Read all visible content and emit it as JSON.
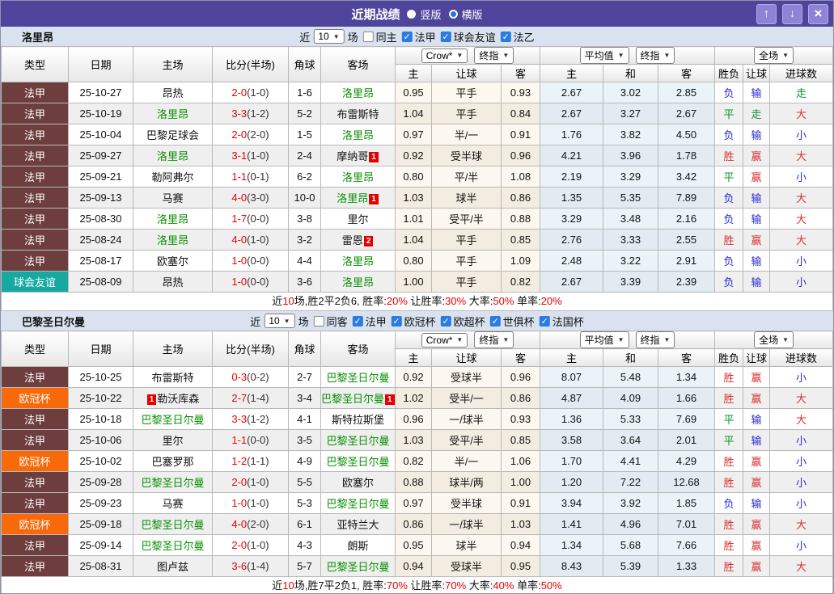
{
  "window": {
    "title": "近期战绩",
    "layout_radios": [
      {
        "label": "竖版",
        "selected": false
      },
      {
        "label": "横版",
        "selected": true
      }
    ],
    "controls": {
      "up": "↑",
      "down": "↓",
      "close": "×"
    },
    "titlebar_color": "#4e449b"
  },
  "table_template": {
    "static_cols": [
      "类型",
      "日期",
      "主场",
      "比分(半场)",
      "角球",
      "客场"
    ],
    "odds_group": {
      "selects": [
        "Crow*",
        "终指"
      ],
      "cols": [
        "主",
        "让球",
        "客"
      ]
    },
    "avg_group": {
      "selects": [
        "平均值",
        "终指"
      ],
      "cols": [
        "主",
        "和",
        "客"
      ]
    },
    "result_group": {
      "selects": [
        "全场"
      ],
      "cols": [
        "胜负",
        "让球",
        "进球数"
      ]
    }
  },
  "league_colors": {
    "法甲": "#6e3e3e",
    "球会友谊": "#17a8a2",
    "欧冠杯": "#f8690a"
  },
  "result_colors": {
    "r": "#d93333",
    "g": "#0b9431",
    "b": "#2b2bd5"
  },
  "team_green": "#089000",
  "sections": [
    {
      "team": "洛里昂",
      "filter": {
        "prefix": "近",
        "count": "10",
        "suffix": "场",
        "venue": {
          "label": "同主",
          "checked": false
        },
        "leagues": [
          {
            "label": "法甲",
            "checked": true
          },
          {
            "label": "球会友谊",
            "checked": true
          },
          {
            "label": "法乙",
            "checked": true
          }
        ]
      },
      "rows": [
        {
          "league": "法甲",
          "date": "25-10-27",
          "home": {
            "name": "昂热"
          },
          "ft": "2-0",
          "ht": "(1-0)",
          "corner": "1-6",
          "away": {
            "name": "洛里昂",
            "green": true
          },
          "crow": [
            "0.95",
            "平手",
            "0.93"
          ],
          "avg": [
            "2.67",
            "3.02",
            "2.85"
          ],
          "res": [
            [
              "负",
              "b"
            ],
            [
              "输",
              "b"
            ],
            [
              "走",
              "g"
            ]
          ]
        },
        {
          "league": "法甲",
          "date": "25-10-19",
          "home": {
            "name": "洛里昂",
            "green": true
          },
          "ft": "3-3",
          "ht": "(1-2)",
          "corner": "5-2",
          "away": {
            "name": "布雷斯特"
          },
          "crow": [
            "1.04",
            "平手",
            "0.84"
          ],
          "avg": [
            "2.67",
            "3.27",
            "2.67"
          ],
          "res": [
            [
              "平",
              "g"
            ],
            [
              "走",
              "g"
            ],
            [
              "大",
              "r"
            ]
          ]
        },
        {
          "league": "法甲",
          "date": "25-10-04",
          "home": {
            "name": "巴黎足球会"
          },
          "ft": "2-0",
          "ht": "(2-0)",
          "corner": "1-5",
          "away": {
            "name": "洛里昂",
            "green": true
          },
          "crow": [
            "0.97",
            "半/一",
            "0.91"
          ],
          "avg": [
            "1.76",
            "3.82",
            "4.50"
          ],
          "res": [
            [
              "负",
              "b"
            ],
            [
              "输",
              "b"
            ],
            [
              "小",
              "b"
            ]
          ]
        },
        {
          "league": "法甲",
          "date": "25-09-27",
          "home": {
            "name": "洛里昂",
            "green": true
          },
          "ft": "3-1",
          "ht": "(1-0)",
          "corner": "2-4",
          "away": {
            "name": "摩纳哥",
            "card": 1
          },
          "crow": [
            "0.92",
            "受半球",
            "0.96"
          ],
          "avg": [
            "4.21",
            "3.96",
            "1.78"
          ],
          "res": [
            [
              "胜",
              "r"
            ],
            [
              "赢",
              "r"
            ],
            [
              "大",
              "r"
            ]
          ]
        },
        {
          "league": "法甲",
          "date": "25-09-21",
          "home": {
            "name": "勒阿弗尔"
          },
          "ft": "1-1",
          "ht": "(0-1)",
          "corner": "6-2",
          "away": {
            "name": "洛里昂",
            "green": true
          },
          "crow": [
            "0.80",
            "平/半",
            "1.08"
          ],
          "avg": [
            "2.19",
            "3.29",
            "3.42"
          ],
          "res": [
            [
              "平",
              "g"
            ],
            [
              "赢",
              "r"
            ],
            [
              "小",
              "b"
            ]
          ]
        },
        {
          "league": "法甲",
          "date": "25-09-13",
          "home": {
            "name": "马赛"
          },
          "ft": "4-0",
          "ht": "(3-0)",
          "corner": "10-0",
          "away": {
            "name": "洛里昂",
            "green": true,
            "card": 1
          },
          "crow": [
            "1.03",
            "球半",
            "0.86"
          ],
          "avg": [
            "1.35",
            "5.35",
            "7.89"
          ],
          "res": [
            [
              "负",
              "b"
            ],
            [
              "输",
              "b"
            ],
            [
              "大",
              "r"
            ]
          ]
        },
        {
          "league": "法甲",
          "date": "25-08-30",
          "home": {
            "name": "洛里昂",
            "green": true
          },
          "ft": "1-7",
          "ht": "(0-0)",
          "corner": "3-8",
          "away": {
            "name": "里尔"
          },
          "crow": [
            "1.01",
            "受平/半",
            "0.88"
          ],
          "avg": [
            "3.29",
            "3.48",
            "2.16"
          ],
          "res": [
            [
              "负",
              "b"
            ],
            [
              "输",
              "b"
            ],
            [
              "大",
              "r"
            ]
          ]
        },
        {
          "league": "法甲",
          "date": "25-08-24",
          "home": {
            "name": "洛里昂",
            "green": true
          },
          "ft": "4-0",
          "ht": "(1-0)",
          "corner": "3-2",
          "away": {
            "name": "雷恩",
            "card": 2
          },
          "crow": [
            "1.04",
            "平手",
            "0.85"
          ],
          "avg": [
            "2.76",
            "3.33",
            "2.55"
          ],
          "res": [
            [
              "胜",
              "r"
            ],
            [
              "赢",
              "r"
            ],
            [
              "大",
              "r"
            ]
          ]
        },
        {
          "league": "法甲",
          "date": "25-08-17",
          "home": {
            "name": "欧塞尔"
          },
          "ft": "1-0",
          "ht": "(0-0)",
          "corner": "4-4",
          "away": {
            "name": "洛里昂",
            "green": true
          },
          "crow": [
            "0.80",
            "平手",
            "1.09"
          ],
          "avg": [
            "2.48",
            "3.22",
            "2.91"
          ],
          "res": [
            [
              "负",
              "b"
            ],
            [
              "输",
              "b"
            ],
            [
              "小",
              "b"
            ]
          ]
        },
        {
          "league": "球会友谊",
          "date": "25-08-09",
          "home": {
            "name": "昂热"
          },
          "ft": "1-0",
          "ht": "(0-0)",
          "corner": "3-6",
          "away": {
            "name": "洛里昂",
            "green": true
          },
          "crow": [
            "1.00",
            "平手",
            "0.82"
          ],
          "avg": [
            "2.67",
            "3.39",
            "2.39"
          ],
          "res": [
            [
              "负",
              "b"
            ],
            [
              "输",
              "b"
            ],
            [
              "小",
              "b"
            ]
          ]
        }
      ],
      "summary": [
        [
          "近",
          0
        ],
        [
          "10",
          1
        ],
        [
          "场,胜2平2负6, 胜率:",
          0
        ],
        [
          "20%",
          1
        ],
        [
          " 让胜率:",
          0
        ],
        [
          "30%",
          1
        ],
        [
          " 大率:",
          0
        ],
        [
          "50%",
          1
        ],
        [
          " 单率:",
          0
        ],
        [
          "20%",
          1
        ]
      ]
    },
    {
      "team": "巴黎圣日尔曼",
      "filter": {
        "prefix": "近",
        "count": "10",
        "suffix": "场",
        "venue": {
          "label": "同客",
          "checked": false
        },
        "leagues": [
          {
            "label": "法甲",
            "checked": true
          },
          {
            "label": "欧冠杯",
            "checked": true
          },
          {
            "label": "欧超杯",
            "checked": true
          },
          {
            "label": "世俱杯",
            "checked": true
          },
          {
            "label": "法国杯",
            "checked": true
          }
        ]
      },
      "rows": [
        {
          "league": "法甲",
          "date": "25-10-25",
          "home": {
            "name": "布雷斯特"
          },
          "ft": "0-3",
          "ht": "(0-2)",
          "corner": "2-7",
          "away": {
            "name": "巴黎圣日尔曼",
            "green": true
          },
          "crow": [
            "0.92",
            "受球半",
            "0.96"
          ],
          "avg": [
            "8.07",
            "5.48",
            "1.34"
          ],
          "res": [
            [
              "胜",
              "r"
            ],
            [
              "赢",
              "r"
            ],
            [
              "小",
              "b"
            ]
          ]
        },
        {
          "league": "欧冠杯",
          "date": "25-10-22",
          "home": {
            "name": "勒沃库森",
            "card": 1,
            "card_side": "before"
          },
          "ft": "2-7",
          "ht": "(1-4)",
          "corner": "3-4",
          "away": {
            "name": "巴黎圣日尔曼",
            "green": true,
            "card": 1
          },
          "crow": [
            "1.02",
            "受半/一",
            "0.86"
          ],
          "avg": [
            "4.87",
            "4.09",
            "1.66"
          ],
          "res": [
            [
              "胜",
              "r"
            ],
            [
              "赢",
              "r"
            ],
            [
              "大",
              "r"
            ]
          ]
        },
        {
          "league": "法甲",
          "date": "25-10-18",
          "home": {
            "name": "巴黎圣日尔曼",
            "green": true
          },
          "ft": "3-3",
          "ht": "(1-2)",
          "corner": "4-1",
          "away": {
            "name": "斯特拉斯堡"
          },
          "crow": [
            "0.96",
            "一/球半",
            "0.93"
          ],
          "avg": [
            "1.36",
            "5.33",
            "7.69"
          ],
          "res": [
            [
              "平",
              "g"
            ],
            [
              "输",
              "b"
            ],
            [
              "大",
              "r"
            ]
          ]
        },
        {
          "league": "法甲",
          "date": "25-10-06",
          "home": {
            "name": "里尔"
          },
          "ft": "1-1",
          "ht": "(0-0)",
          "corner": "3-5",
          "away": {
            "name": "巴黎圣日尔曼",
            "green": true
          },
          "crow": [
            "1.03",
            "受平/半",
            "0.85"
          ],
          "avg": [
            "3.58",
            "3.64",
            "2.01"
          ],
          "res": [
            [
              "平",
              "g"
            ],
            [
              "输",
              "b"
            ],
            [
              "小",
              "b"
            ]
          ]
        },
        {
          "league": "欧冠杯",
          "date": "25-10-02",
          "home": {
            "name": "巴塞罗那"
          },
          "ft": "1-2",
          "ht": "(1-1)",
          "corner": "4-9",
          "away": {
            "name": "巴黎圣日尔曼",
            "green": true
          },
          "crow": [
            "0.82",
            "半/一",
            "1.06"
          ],
          "avg": [
            "1.70",
            "4.41",
            "4.29"
          ],
          "res": [
            [
              "胜",
              "r"
            ],
            [
              "赢",
              "r"
            ],
            [
              "小",
              "b"
            ]
          ]
        },
        {
          "league": "法甲",
          "date": "25-09-28",
          "home": {
            "name": "巴黎圣日尔曼",
            "green": true
          },
          "ft": "2-0",
          "ht": "(1-0)",
          "corner": "5-5",
          "away": {
            "name": "欧塞尔"
          },
          "crow": [
            "0.88",
            "球半/两",
            "1.00"
          ],
          "avg": [
            "1.20",
            "7.22",
            "12.68"
          ],
          "res": [
            [
              "胜",
              "r"
            ],
            [
              "赢",
              "r"
            ],
            [
              "小",
              "b"
            ]
          ]
        },
        {
          "league": "法甲",
          "date": "25-09-23",
          "home": {
            "name": "马赛"
          },
          "ft": "1-0",
          "ht": "(1-0)",
          "corner": "5-3",
          "away": {
            "name": "巴黎圣日尔曼",
            "green": true
          },
          "crow": [
            "0.97",
            "受半球",
            "0.91"
          ],
          "avg": [
            "3.94",
            "3.92",
            "1.85"
          ],
          "res": [
            [
              "负",
              "b"
            ],
            [
              "输",
              "b"
            ],
            [
              "小",
              "b"
            ]
          ]
        },
        {
          "league": "欧冠杯",
          "date": "25-09-18",
          "home": {
            "name": "巴黎圣日尔曼",
            "green": true
          },
          "ft": "4-0",
          "ht": "(2-0)",
          "corner": "6-1",
          "away": {
            "name": "亚特兰大"
          },
          "crow": [
            "0.86",
            "一/球半",
            "1.03"
          ],
          "avg": [
            "1.41",
            "4.96",
            "7.01"
          ],
          "res": [
            [
              "胜",
              "r"
            ],
            [
              "赢",
              "r"
            ],
            [
              "大",
              "r"
            ]
          ]
        },
        {
          "league": "法甲",
          "date": "25-09-14",
          "home": {
            "name": "巴黎圣日尔曼",
            "green": true
          },
          "ft": "2-0",
          "ht": "(1-0)",
          "corner": "4-3",
          "away": {
            "name": "朗斯"
          },
          "crow": [
            "0.95",
            "球半",
            "0.94"
          ],
          "avg": [
            "1.34",
            "5.68",
            "7.66"
          ],
          "res": [
            [
              "胜",
              "r"
            ],
            [
              "赢",
              "r"
            ],
            [
              "小",
              "b"
            ]
          ]
        },
        {
          "league": "法甲",
          "date": "25-08-31",
          "home": {
            "name": "图卢兹"
          },
          "ft": "3-6",
          "ht": "(1-4)",
          "corner": "5-7",
          "away": {
            "name": "巴黎圣日尔曼",
            "green": true
          },
          "crow": [
            "0.94",
            "受球半",
            "0.95"
          ],
          "avg": [
            "8.43",
            "5.39",
            "1.33"
          ],
          "res": [
            [
              "胜",
              "r"
            ],
            [
              "赢",
              "r"
            ],
            [
              "大",
              "r"
            ]
          ]
        }
      ],
      "summary": [
        [
          "近",
          0
        ],
        [
          "10",
          1
        ],
        [
          "场,胜7平2负1, 胜率:",
          0
        ],
        [
          "70%",
          1
        ],
        [
          " 让胜率:",
          0
        ],
        [
          "70%",
          1
        ],
        [
          " 大率:",
          0
        ],
        [
          "40%",
          1
        ],
        [
          " 单率:",
          0
        ],
        [
          "50%",
          1
        ]
      ]
    }
  ]
}
